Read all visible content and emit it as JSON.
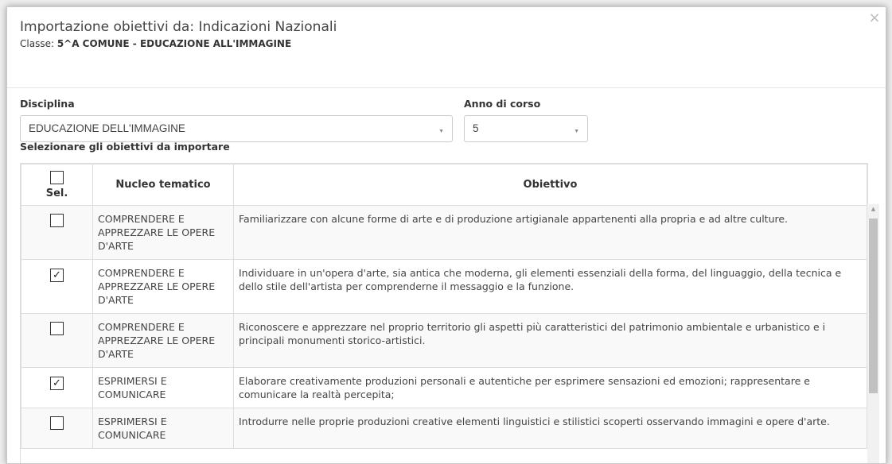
{
  "modal": {
    "title": "Importazione obiettivi da: Indicazioni Nazionali",
    "subtitle_prefix": "Classe: ",
    "subtitle_value": "5^A COMUNE - EDUCAZIONE ALL'IMMAGINE",
    "close_glyph": "×"
  },
  "filters": {
    "disciplina_label": "Disciplina",
    "disciplina_value": "EDUCAZIONE DELL'IMMAGINE",
    "anno_label": "Anno di corso",
    "anno_value": "5",
    "arrow_glyph": "▼"
  },
  "section_label": "Selezionare gli obiettivi da importare",
  "table": {
    "headers": {
      "sel": "Sel.",
      "nucleo": "Nucleo tematico",
      "obiettivo": "Obiettivo"
    },
    "check_glyph": "✓",
    "rows": [
      {
        "checked": false,
        "nucleo": "COMPRENDERE E APPREZZARE LE OPERE D'ARTE",
        "obiettivo": "Familiarizzare con alcune forme di arte e di produzione artigianale appartenenti alla propria e ad altre culture."
      },
      {
        "checked": true,
        "nucleo": "COMPRENDERE E APPREZZARE LE OPERE D'ARTE",
        "obiettivo": "Individuare in un'opera d'arte, sia antica che moderna, gli elementi essenziali della forma, del linguaggio, della tecnica e dello stile dell'artista per comprenderne il messaggio e la funzione."
      },
      {
        "checked": false,
        "nucleo": "COMPRENDERE E APPREZZARE LE OPERE D'ARTE",
        "obiettivo": "Riconoscere e apprezzare nel proprio territorio gli aspetti più caratteristici del patrimonio ambientale e urbanistico e i principali monumenti storico-artistici."
      },
      {
        "checked": true,
        "nucleo": "ESPRIMERSI E COMUNICARE",
        "obiettivo": "Elaborare creativamente produzioni personali e autentiche per esprimere sensazioni ed emozioni; rappresentare e comunicare la realtà percepita;"
      },
      {
        "checked": false,
        "nucleo": "ESPRIMERSI E COMUNICARE",
        "obiettivo": "Introdurre nelle proprie produzioni creative elementi linguistici e stilistici scoperti osservando immagini e opere d'arte."
      }
    ]
  },
  "icons": {
    "close": "close-icon",
    "dropdown": "chevron-down-icon",
    "check": "check-icon"
  }
}
